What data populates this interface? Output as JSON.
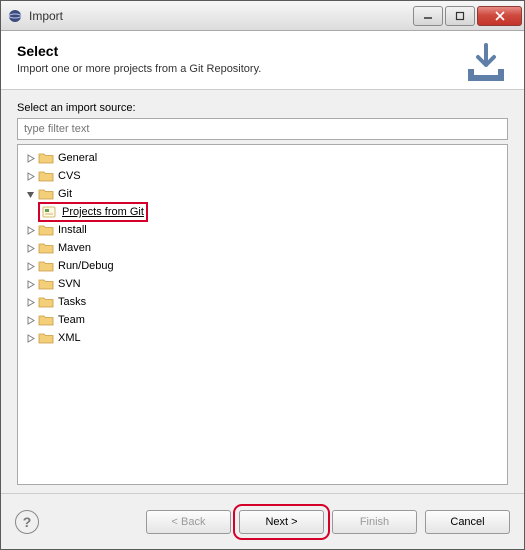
{
  "window": {
    "title": "Import"
  },
  "banner": {
    "heading": "Select",
    "sub": "Import one or more projects from a Git Repository."
  },
  "content": {
    "source_label": "Select an import source:",
    "filter_placeholder": "type filter text"
  },
  "tree": {
    "nodes": [
      {
        "label": "General",
        "expanded": false
      },
      {
        "label": "CVS",
        "expanded": false
      },
      {
        "label": "Git",
        "expanded": true,
        "children": [
          {
            "label": "Projects from Git",
            "selected": true
          }
        ]
      },
      {
        "label": "Install",
        "expanded": false
      },
      {
        "label": "Maven",
        "expanded": false
      },
      {
        "label": "Run/Debug",
        "expanded": false
      },
      {
        "label": "SVN",
        "expanded": false
      },
      {
        "label": "Tasks",
        "expanded": false
      },
      {
        "label": "Team",
        "expanded": false
      },
      {
        "label": "XML",
        "expanded": false
      }
    ]
  },
  "buttons": {
    "back": "< Back",
    "next": "Next >",
    "finish": "Finish",
    "cancel": "Cancel"
  }
}
